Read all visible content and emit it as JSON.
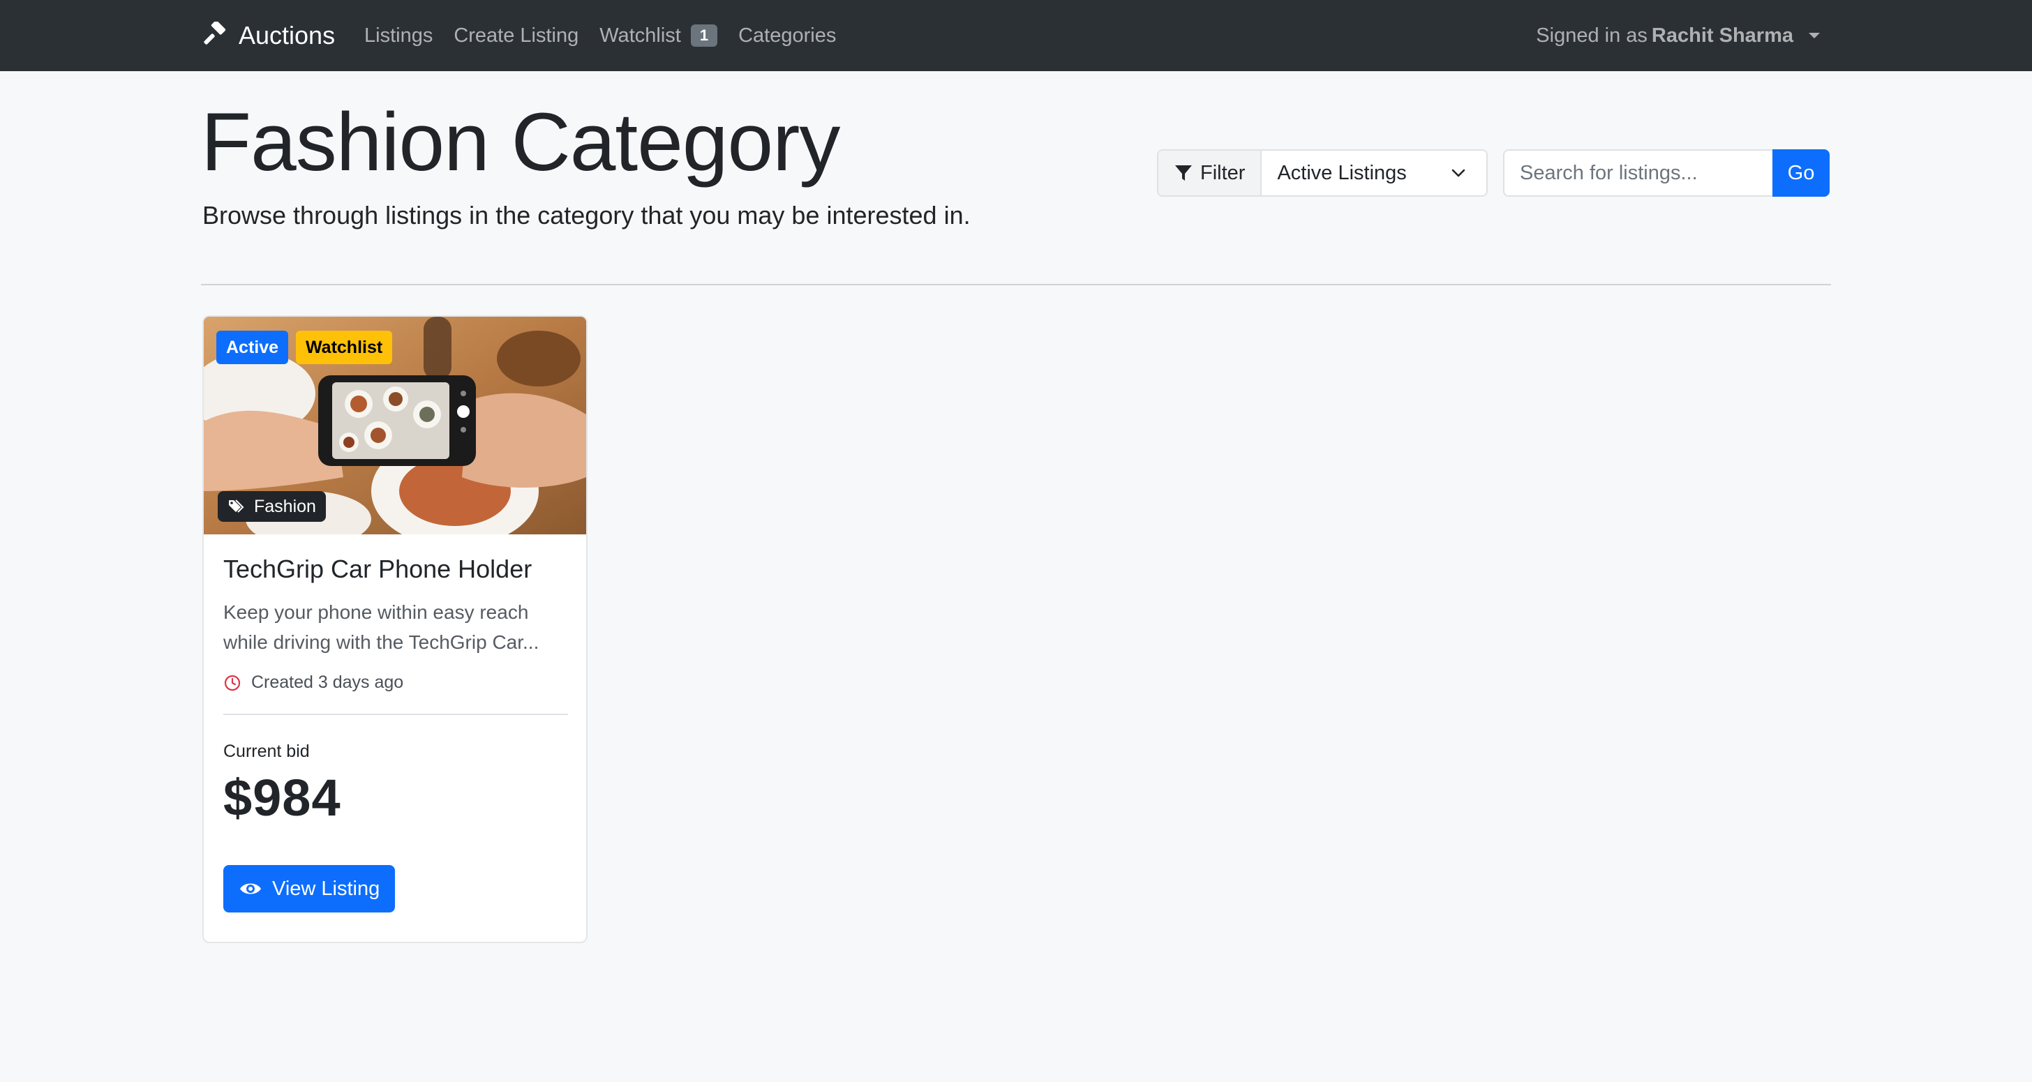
{
  "navbar": {
    "brand": "Auctions",
    "links": [
      {
        "label": "Listings"
      },
      {
        "label": "Create Listing"
      },
      {
        "label": "Watchlist",
        "count": "1"
      },
      {
        "label": "Categories"
      }
    ],
    "user_prefix": "Signed in as",
    "user_name": "Rachit Sharma"
  },
  "header": {
    "title": "Fashion Category",
    "subtitle": "Browse through listings in the category that you may be interested in."
  },
  "filter": {
    "label": "Filter",
    "selected": "Active Listings"
  },
  "search": {
    "placeholder": "Search for listings...",
    "button": "Go"
  },
  "listings": [
    {
      "status": "Active",
      "watchlist": "Watchlist",
      "category": "Fashion",
      "title": "TechGrip Car Phone Holder",
      "description": "Keep your phone within easy reach while driving with the TechGrip Car...",
      "created": "Created 3 days ago",
      "bid_label": "Current bid",
      "bid": "$984",
      "button": "View Listing"
    }
  ],
  "colors": {
    "navbar": "#2b3035",
    "primary": "#0d6efd",
    "warning": "#ffc107",
    "danger": "#dc3545"
  }
}
